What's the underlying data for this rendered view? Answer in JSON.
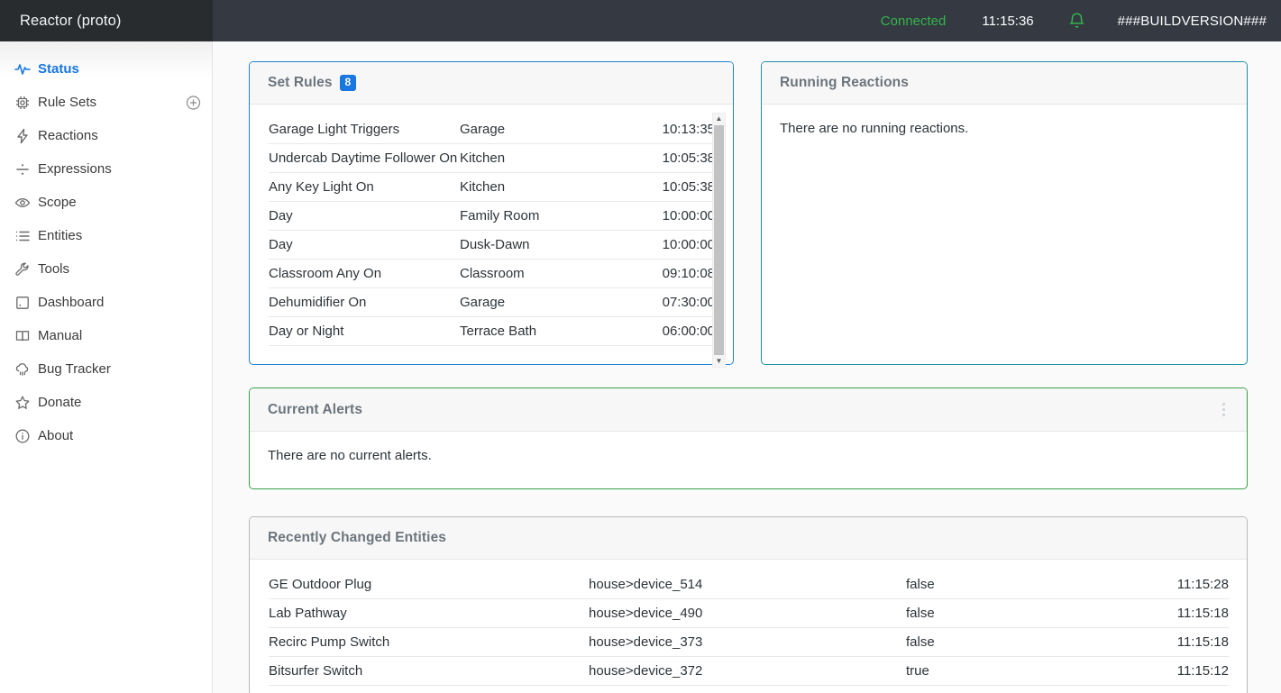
{
  "header": {
    "brand_title": "Reactor (proto)",
    "connection_status": "Connected",
    "clock": "11:15:36",
    "bell_icon": "bell-icon",
    "build_version": "###BUILDVERSION###",
    "connected_color": "#32b44a"
  },
  "sidebar": {
    "items": [
      {
        "label": "Status",
        "icon": "activity-pulse-icon",
        "active": true
      },
      {
        "label": "Rule Sets",
        "icon": "chip-icon",
        "active": false,
        "action_icon": "plus-circle-icon"
      },
      {
        "label": "Reactions",
        "icon": "lightning-bolt-icon",
        "active": false
      },
      {
        "label": "Expressions",
        "icon": "divide-icon",
        "active": false
      },
      {
        "label": "Scope",
        "icon": "eye-icon",
        "active": false
      },
      {
        "label": "Entities",
        "icon": "list-icon",
        "active": false
      },
      {
        "label": "Tools",
        "icon": "wrench-icon",
        "active": false
      },
      {
        "label": "Dashboard",
        "icon": "dashboard-icon",
        "active": false
      },
      {
        "label": "Manual",
        "icon": "book-icon",
        "active": false
      },
      {
        "label": "Bug Tracker",
        "icon": "bug-cloud-icon",
        "active": false
      },
      {
        "label": "Donate",
        "icon": "star-icon",
        "active": false
      },
      {
        "label": "About",
        "icon": "info-circle-icon",
        "active": false
      }
    ]
  },
  "set_rules": {
    "title": "Set Rules",
    "count": "8",
    "border_color": "#2080d4",
    "rows": [
      {
        "name": "Garage Light Triggers",
        "place": "Garage",
        "time": "10:13:35"
      },
      {
        "name": "Undercab Daytime Follower On",
        "place": "Kitchen",
        "time": "10:05:38"
      },
      {
        "name": "Any Key Light On",
        "place": "Kitchen",
        "time": "10:05:38"
      },
      {
        "name": "Day",
        "place": "Family Room",
        "time": "10:00:00"
      },
      {
        "name": "Day",
        "place": "Dusk-Dawn",
        "time": "10:00:00"
      },
      {
        "name": "Classroom Any On",
        "place": "Classroom",
        "time": "09:10:08"
      },
      {
        "name": "Dehumidifier On",
        "place": "Garage",
        "time": "07:30:00"
      },
      {
        "name": "Day or Night",
        "place": "Terrace Bath",
        "time": "06:00:00"
      }
    ],
    "scroll_up_icon": "triangle-up-icon",
    "scroll_down_icon": "triangle-down-icon"
  },
  "running_reactions": {
    "title": "Running Reactions",
    "empty_text": "There are no running reactions.",
    "border_color": "#1c8fa8"
  },
  "current_alerts": {
    "title": "Current Alerts",
    "empty_text": "There are no current alerts.",
    "menu_icon": "kebab-menu-icon",
    "border_color": "#35a247"
  },
  "recently_changed_entities": {
    "title": "Recently Changed Entities",
    "border_color": "#b9b9b9",
    "rows": [
      {
        "name": "GE Outdoor Plug",
        "id": "house>device_514",
        "value": "false",
        "time": "11:15:28"
      },
      {
        "name": "Lab Pathway",
        "id": "house>device_490",
        "value": "false",
        "time": "11:15:18"
      },
      {
        "name": "Recirc Pump Switch",
        "id": "house>device_373",
        "value": "false",
        "time": "11:15:18"
      },
      {
        "name": "Bitsurfer Switch",
        "id": "house>device_372",
        "value": "true",
        "time": "11:15:12"
      }
    ]
  }
}
